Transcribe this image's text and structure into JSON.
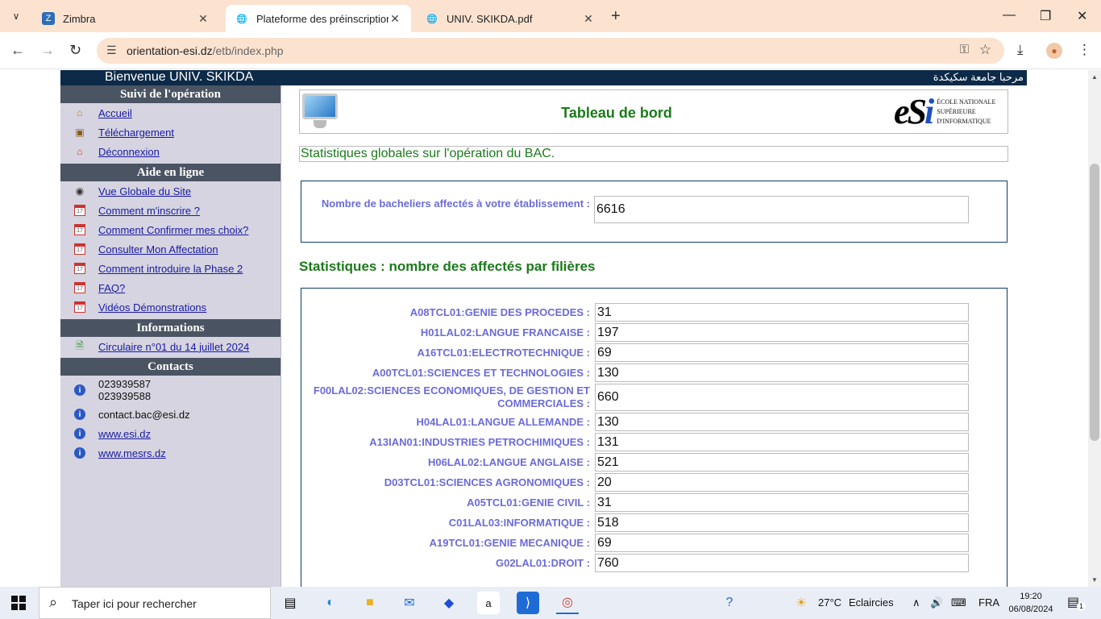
{
  "browser": {
    "tabs": [
      {
        "title": "Zimbra"
      },
      {
        "title": "Plateforme des préinscriptions"
      },
      {
        "title": "UNIV. SKIKDA.pdf"
      }
    ],
    "url_host": "orientation-esi.dz",
    "url_path": "/etb/index.php"
  },
  "banner": {
    "welcome": "Bienvenue UNIV. SKIKDA",
    "arabic": "مرحبا جامعة سكيكدة"
  },
  "sidebar": {
    "sections": [
      {
        "title": "Suivi de l'opération",
        "items": [
          "Accueil",
          "Téléchargement",
          "Déconnexion"
        ]
      },
      {
        "title": "Aide en ligne",
        "items": [
          "Vue Globale du Site",
          "Comment m'inscrire ?",
          "Comment Confirmer mes choix?",
          "Consulter Mon Affectation",
          "Comment introduire la Phase 2",
          "FAQ?",
          "Vidéos Démonstrations"
        ]
      },
      {
        "title": "Informations",
        "items": [
          "Circulaire n°01 du 14 juillet 2024"
        ]
      },
      {
        "title": "Contacts",
        "phone1": "023939587",
        "phone2": "023939588",
        "email": "contact.bac@esi.dz",
        "links": [
          "www.esi.dz",
          "www.mesrs.dz"
        ]
      }
    ]
  },
  "main": {
    "title": "Tableau de bord",
    "logo_lines": [
      "ÉCOLE NATIONALE",
      "SUPÉRIEURE",
      "D'INFORMATIQUE"
    ],
    "subtitle": "Statistiques globales sur l'opération du BAC.",
    "total_label": "Nombre de bacheliers affectés à votre établissement :",
    "total_value": "6616",
    "section_title": "Statistiques : nombre des affectés par filières",
    "filieres": [
      {
        "label": "A08TCL01:GENIE DES PROCEDES :",
        "value": "31"
      },
      {
        "label": "H01LAL02:LANGUE FRANCAISE :",
        "value": "197"
      },
      {
        "label": "A16TCL01:ELECTROTECHNIQUE :",
        "value": "69"
      },
      {
        "label": "A00TCL01:SCIENCES ET TECHNOLOGIES :",
        "value": "130"
      },
      {
        "label": "F00LAL02:SCIENCES ECONOMIQUES, DE GESTION ET COMMERCIALES :",
        "value": "660"
      },
      {
        "label": "H04LAL01:LANGUE ALLEMANDE :",
        "value": "130"
      },
      {
        "label": "A13IAN01:INDUSTRIES PETROCHIMIQUES :",
        "value": "131"
      },
      {
        "label": "H06LAL02:LANGUE ANGLAISE :",
        "value": "521"
      },
      {
        "label": "D03TCL01:SCIENCES AGRONOMIQUES :",
        "value": "20"
      },
      {
        "label": "A05TCL01:GENIE CIVIL :",
        "value": "31"
      },
      {
        "label": "C01LAL03:INFORMATIQUE :",
        "value": "518"
      },
      {
        "label": "A19TCL01:GENIE MECANIQUE :",
        "value": "69"
      },
      {
        "label": "G02LAL01:DROIT :",
        "value": "760"
      }
    ]
  },
  "taskbar": {
    "search_placeholder": "Taper ici pour rechercher",
    "weather_temp": "27°C",
    "weather_text": "Eclaircies",
    "language": "FRA",
    "time": "19:20",
    "date": "06/08/2024",
    "notifications": "1"
  },
  "colors": {
    "banner": "#0d2a48",
    "sidebar_bg": "#d5d4e0",
    "sidebar_head": "#4a5462",
    "title_green": "#1b7a1b",
    "label_blue": "#6b6bd8",
    "link": "#1a1aa6"
  }
}
